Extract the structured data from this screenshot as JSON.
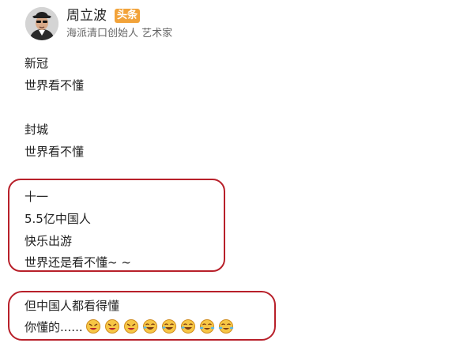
{
  "author": {
    "name": "周立波",
    "badge": "头条",
    "description": "海派清口创始人 艺术家"
  },
  "post": {
    "lines": [
      "新冠",
      "世界看不懂",
      "封城",
      "世界看不懂",
      "十一",
      "5.5亿中国人",
      "快乐出游",
      "世界还是看不懂~ ~",
      "但中国人都看得懂",
      "你懂的......"
    ],
    "emojis": [
      "angry-face-icon",
      "angry-face-icon",
      "angry-face-icon",
      "laughing-face-icon",
      "laughing-face-icon",
      "laughing-face-icon",
      "crying-laughing-face-icon",
      "crying-laughing-face-icon"
    ]
  },
  "colors": {
    "highlight_border": "#b8202a",
    "badge_background": "#f2a33a",
    "text": "#222222",
    "muted_text": "#666666"
  }
}
